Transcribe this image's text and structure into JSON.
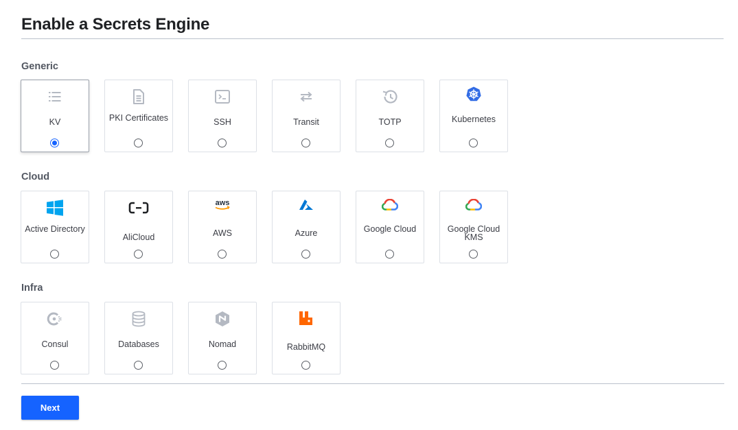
{
  "page": {
    "title": "Enable a Secrets Engine"
  },
  "sections": {
    "generic": {
      "heading": "Generic",
      "items": [
        {
          "label": "KV",
          "icon": "list-icon",
          "selected": true
        },
        {
          "label": "PKI Certificates",
          "icon": "document-icon",
          "selected": false
        },
        {
          "label": "SSH",
          "icon": "terminal-icon",
          "selected": false
        },
        {
          "label": "Transit",
          "icon": "swap-arrows-icon",
          "selected": false
        },
        {
          "label": "TOTP",
          "icon": "history-clock-icon",
          "selected": false
        },
        {
          "label": "Kubernetes",
          "icon": "kubernetes-icon",
          "selected": false
        }
      ]
    },
    "cloud": {
      "heading": "Cloud",
      "items": [
        {
          "label": "Active Directory",
          "icon": "windows-icon",
          "selected": false
        },
        {
          "label": "AliCloud",
          "icon": "alicloud-icon",
          "selected": false
        },
        {
          "label": "AWS",
          "icon": "aws-icon",
          "selected": false
        },
        {
          "label": "Azure",
          "icon": "azure-icon",
          "selected": false
        },
        {
          "label": "Google Cloud",
          "icon": "google-cloud-icon",
          "selected": false
        },
        {
          "label": "Google Cloud KMS",
          "icon": "google-cloud-kms-icon",
          "selected": false
        }
      ]
    },
    "infra": {
      "heading": "Infra",
      "items": [
        {
          "label": "Consul",
          "icon": "consul-icon",
          "selected": false
        },
        {
          "label": "Databases",
          "icon": "database-icon",
          "selected": false
        },
        {
          "label": "Nomad",
          "icon": "nomad-icon",
          "selected": false
        },
        {
          "label": "RabbitMQ",
          "icon": "rabbitmq-icon",
          "selected": false
        }
      ]
    }
  },
  "footer": {
    "next_label": "Next"
  },
  "colors": {
    "primary": "#1563ff",
    "icon_gray": "#b4b9c2",
    "windows": "#00a4ef",
    "aws_orange": "#ff9900",
    "azure": "#0078d4",
    "kubernetes": "#326ce5",
    "rabbitmq": "#ff6600"
  }
}
